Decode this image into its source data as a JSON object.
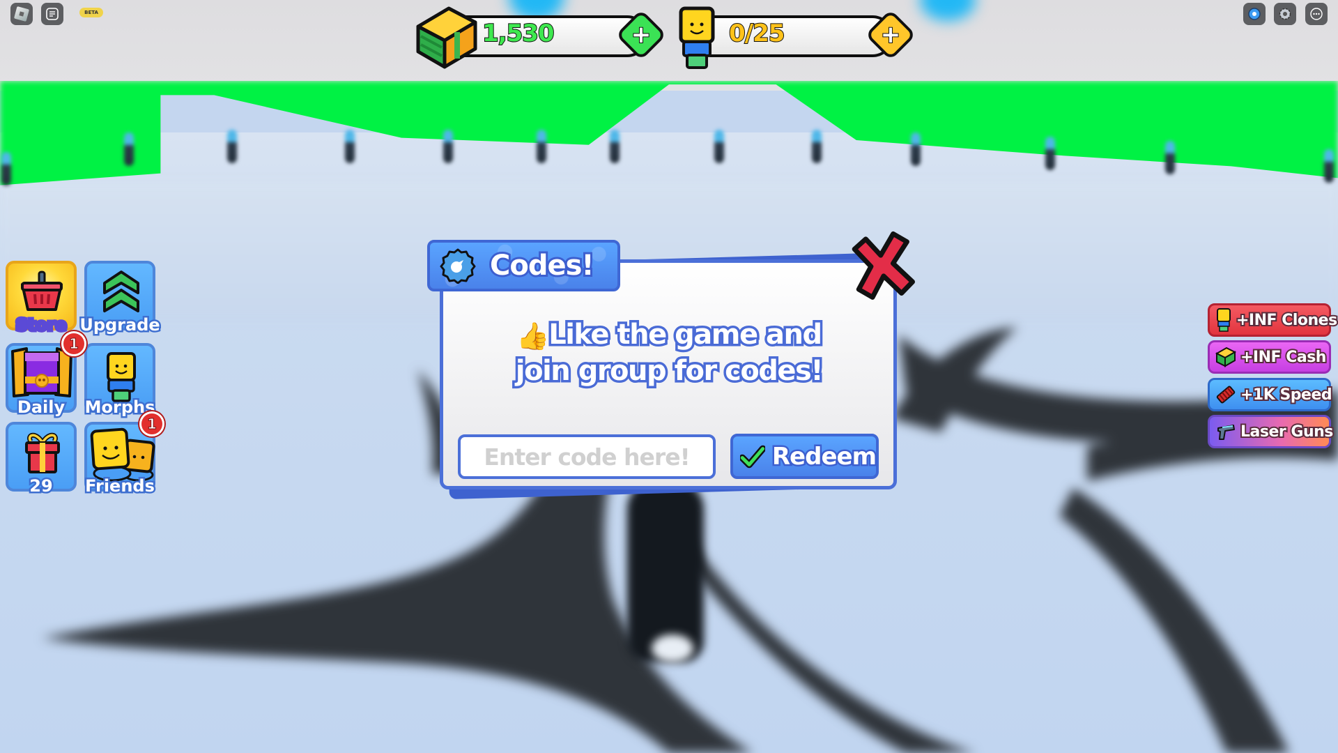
{
  "roblox_topbar": {
    "left_icons": [
      "roblox-menu-icon",
      "chat-icon"
    ],
    "beta_badge": "BETA",
    "right_icons": [
      "record-icon",
      "settings-icon",
      "more-icon"
    ]
  },
  "currency": {
    "cash": {
      "icon": "cash-stack-icon",
      "value": "1,530",
      "color": "#3ee84f",
      "add_icon": "plus-icon",
      "button_color": "#3be255"
    },
    "clones": {
      "icon": "noob-character-icon",
      "value": "0/25",
      "color": "#ffc21a",
      "add_icon": "plus-icon",
      "button_color": "#ffc62a"
    }
  },
  "left_menu": {
    "items": [
      {
        "id": "store",
        "label": "Store",
        "icon": "basket-icon"
      },
      {
        "id": "upgrade",
        "label": "Upgrade",
        "icon": "double-chevron-up-icon"
      },
      {
        "id": "daily",
        "label": "Daily",
        "icon": "treasure-chest-icon",
        "badge": "1"
      },
      {
        "id": "morphs",
        "label": "Morphs",
        "icon": "noob-character-icon"
      },
      {
        "id": "gift",
        "label": "29",
        "icon": "gift-icon"
      },
      {
        "id": "friends",
        "label": "Friends",
        "icon": "friends-icon",
        "badge": "1"
      }
    ]
  },
  "promos": [
    {
      "label": "+INF Clones",
      "icon": "noob-character-icon",
      "color_from": "#f2414b",
      "color_to": "#e8333d",
      "border": "#b52232"
    },
    {
      "label": "+INF Cash",
      "icon": "cash-stack-icon",
      "color_from": "#e45cf0",
      "color_to": "#c43fe0",
      "border": "#9a2cb5"
    },
    {
      "label": "+1K Speed",
      "icon": "spring-icon",
      "color_from": "#52b6ff",
      "color_to": "#3e8ff0",
      "border": "#2e69c9"
    },
    {
      "label": "Laser Guns",
      "icon": "laser-gun-icon",
      "color_from": "#7b5cf0",
      "color_to": "#ff8a55",
      "border": "#6a4ac4"
    }
  ],
  "codes_dialog": {
    "title": "Codes!",
    "title_icon": "verified-badge-icon",
    "message_emoji": "👍",
    "message_line1": "Like the game and",
    "message_line2": "join group for codes!",
    "input_placeholder": "Enter code here!",
    "input_value": "",
    "redeem_label": "Redeem",
    "redeem_icon": "checkmark-icon",
    "close_icon": "close-x-icon"
  }
}
